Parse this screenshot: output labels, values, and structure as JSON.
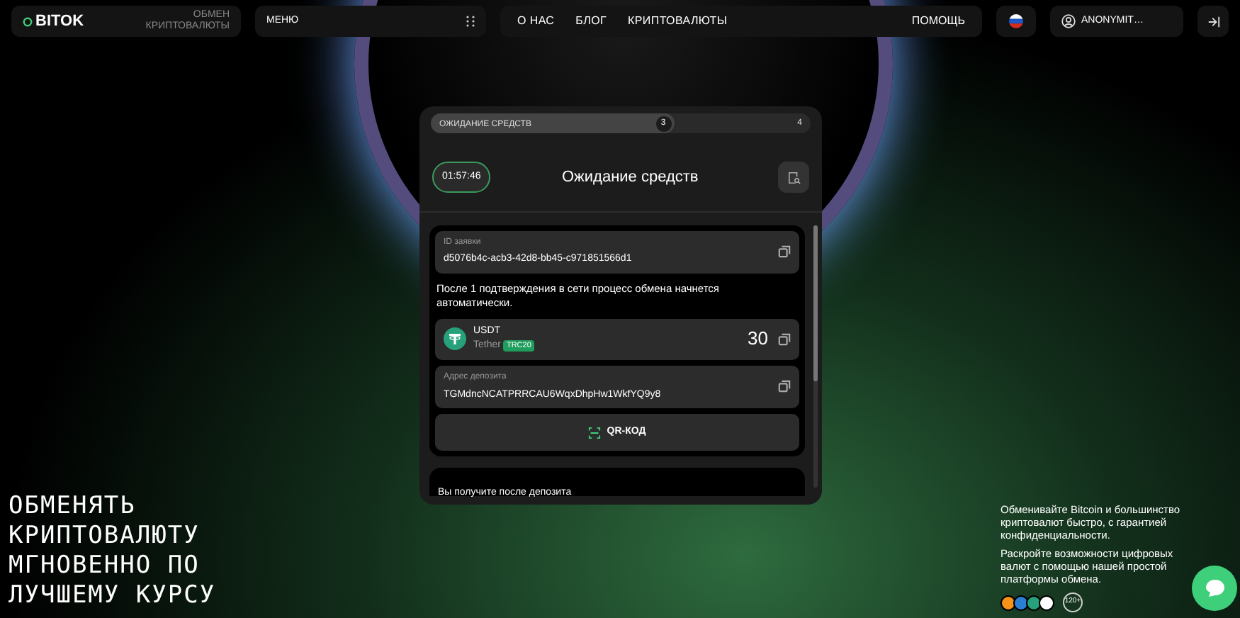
{
  "header": {
    "logo": "BITOK",
    "tagline": "ОБМЕН КРИПТОВАЛЮТЫ",
    "menu": "МЕНЮ",
    "nav": [
      {
        "label": "О НАС"
      },
      {
        "label": "БЛОГ"
      },
      {
        "label": "КРИПТОВАЛЮТЫ"
      }
    ],
    "help": "ПОМОЩЬ",
    "user": "ANONYMIT…"
  },
  "order": {
    "progress": {
      "label": "ОЖИДАНИЕ СРЕДСТВ",
      "level": 0.64,
      "steps": [
        "3",
        "4"
      ]
    },
    "timer": "01:57:46",
    "title": "Ожидание средств",
    "id_label": "ID заявки",
    "id_value": "d5076b4c-acb3-42d8-bb45-c971851566d1",
    "notice": "После 1 подтверждения в сети процесс обмена начнется автоматически.",
    "coin": {
      "ticker": "USDT",
      "name": "Tether",
      "network": "TRC20",
      "amount": "30"
    },
    "address_label": "Адрес депозита",
    "address_value": "TGMdncNCATPRRCAU6WqxDhpHw1WkfYQ9y8",
    "qr_button": "QR-КОД",
    "receive_label": "Вы получите после депозита"
  },
  "hero": [
    "ОБМЕНЯТЬ",
    "КРИПТОВАЛЮТУ",
    "МГНОВЕННО ПО",
    "ЛУЧШЕМУ КУРСУ"
  ],
  "info": {
    "paragraphs": [
      "Обменивайте Bitcoin и большинство криптовалют быстро, с гарантией конфиденциальности.",
      "Раскройте возможности цифровых валют с помощью нашей простой платформы обмена."
    ],
    "coins": [
      {
        "color": "#f7931a"
      },
      {
        "color": "#2a7fd4"
      },
      {
        "color": "#26a17b"
      },
      {
        "color": "#ffffff"
      }
    ],
    "more": "120+"
  }
}
